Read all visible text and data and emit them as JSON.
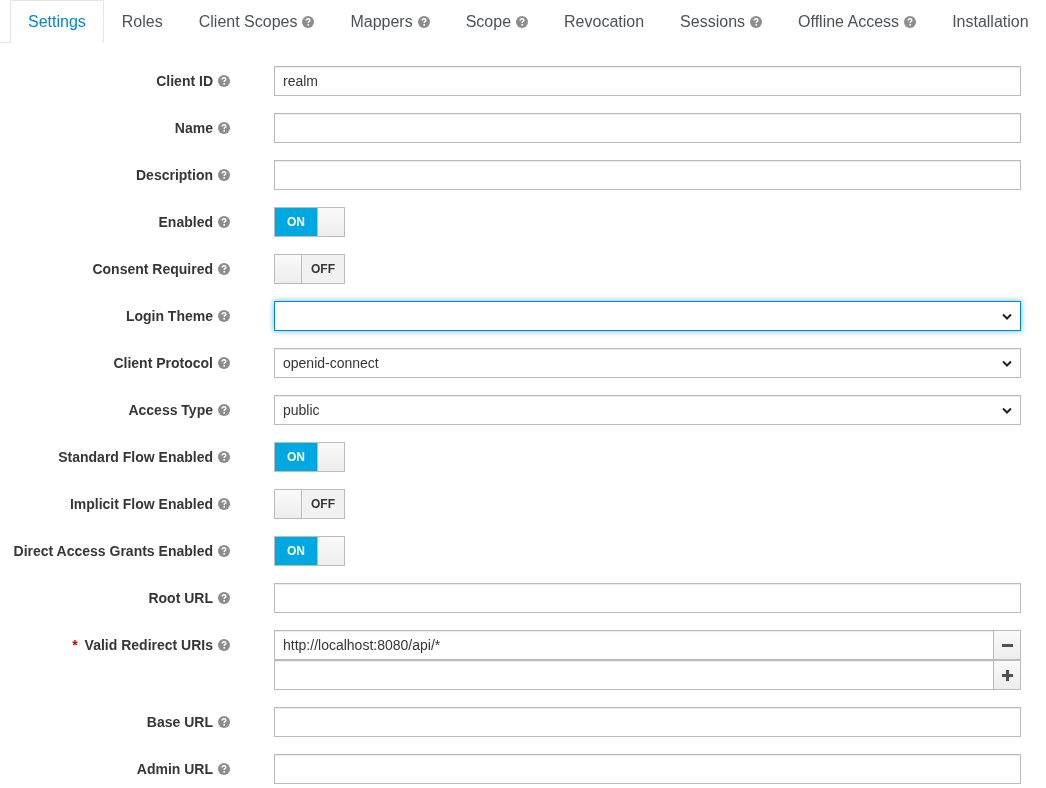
{
  "tabs": [
    {
      "label": "Settings",
      "selected": true,
      "help": false
    },
    {
      "label": "Roles",
      "selected": false,
      "help": false
    },
    {
      "label": "Client Scopes",
      "selected": false,
      "help": true
    },
    {
      "label": "Mappers",
      "selected": false,
      "help": true
    },
    {
      "label": "Scope",
      "selected": false,
      "help": true
    },
    {
      "label": "Revocation",
      "selected": false,
      "help": false
    },
    {
      "label": "Sessions",
      "selected": false,
      "help": true
    },
    {
      "label": "Offline Access",
      "selected": false,
      "help": true
    },
    {
      "label": "Installation",
      "selected": false,
      "help": false
    }
  ],
  "fields": [
    {
      "label": "Client ID",
      "kind": "text",
      "value": "realm"
    },
    {
      "label": "Name",
      "kind": "text"
    },
    {
      "label": "Description",
      "kind": "text"
    },
    {
      "label": "Enabled",
      "kind": "toggle",
      "on": true,
      "text": "ON"
    },
    {
      "label": "Consent Required",
      "kind": "toggle",
      "on": false,
      "text": "OFF"
    },
    {
      "label": "Login Theme",
      "kind": "select",
      "focused": true
    },
    {
      "label": "Client Protocol",
      "kind": "select",
      "value": "openid-connect",
      "focused": false
    },
    {
      "label": "Access Type",
      "kind": "select",
      "value": "public",
      "focused": false
    },
    {
      "label": "Standard Flow Enabled",
      "kind": "toggle",
      "on": true,
      "text": "ON"
    },
    {
      "label": "Implicit Flow Enabled",
      "kind": "toggle",
      "on": false,
      "text": "OFF"
    },
    {
      "label": "Direct Access Grants Enabled",
      "kind": "toggle",
      "on": true,
      "text": "ON"
    },
    {
      "label": "Root URL",
      "kind": "text"
    },
    {
      "label": "Valid Redirect URIs",
      "kind": "multi",
      "required_mark": "*",
      "values": [
        "http://localhost:8080/api/*"
      ]
    },
    {
      "label": "Base URL",
      "kind": "text"
    },
    {
      "label": "Admin URL",
      "kind": "text"
    }
  ]
}
